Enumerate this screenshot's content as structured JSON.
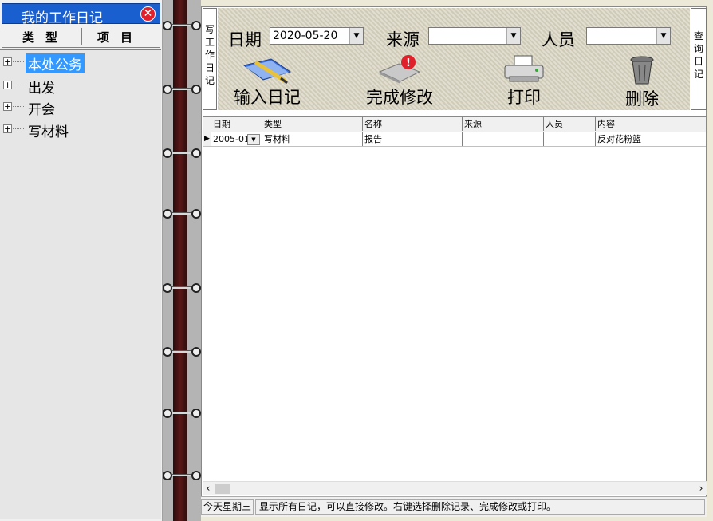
{
  "panel": {
    "title": "我的工作日记",
    "columns": [
      "类型",
      "项目"
    ],
    "tree": [
      {
        "label": "本处公务",
        "selected": true
      },
      {
        "label": "出发",
        "selected": false
      },
      {
        "label": "开会",
        "selected": false
      },
      {
        "label": "写材料",
        "selected": false
      }
    ]
  },
  "tabs": {
    "write": "写工作日记",
    "query": "查询日记"
  },
  "filters": {
    "date_label": "日期",
    "date_value": "2020-05-20",
    "source_label": "来源",
    "source_value": "",
    "person_label": "人员",
    "person_value": ""
  },
  "toolbar": {
    "input": "输入日记",
    "finish": "完成修改",
    "print": "打印",
    "delete": "删除"
  },
  "grid": {
    "headers": [
      "日期",
      "类型",
      "名称",
      "来源",
      "人员",
      "内容"
    ],
    "rows": [
      [
        "2005-01",
        "写材料",
        "报告",
        "",
        "",
        "反对花粉篮"
      ]
    ]
  },
  "status": {
    "weekday": "今天星期三",
    "hint": "显示所有日记，可以直接修改。右键选择删除记录、完成修改或打印。"
  },
  "colors": {
    "title_bar": "#1a5fd0",
    "selection": "#3399ff",
    "close": "#e0202a"
  }
}
